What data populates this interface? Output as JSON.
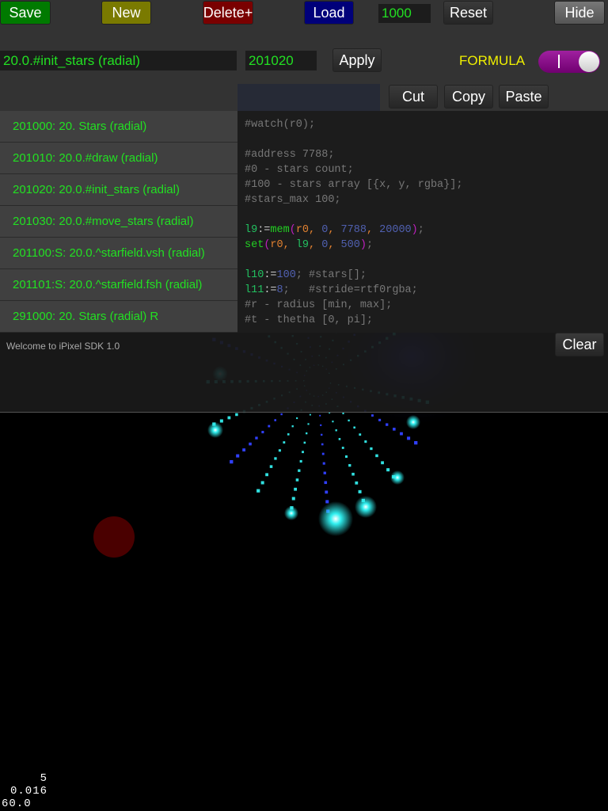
{
  "toolbar": {
    "save": "Save",
    "new": "New",
    "delete": "Delete+",
    "load": "Load",
    "count_value": "1000",
    "reset": "Reset",
    "hide": "Hide"
  },
  "editor": {
    "name_value": "20.0.#init_stars (radial)",
    "id_value": "201020",
    "apply": "Apply",
    "mode_label": "FORMULA",
    "mode_on": true,
    "cut": "Cut",
    "copy": "Copy",
    "paste": "Paste"
  },
  "list": [
    "201000: 20. Stars (radial)",
    "201010: 20.0.#draw (radial)",
    "201020: 20.0.#init_stars (radial)",
    "201030: 20.0.#move_stars (radial)",
    "201100:S: 20.0.^starfield.vsh (radial)",
    "201101:S: 20.0.^starfield.fsh (radial)",
    "291000: 20. Stars (radial) R"
  ],
  "code": {
    "l1": "#watch(r0);",
    "l3": "#address 7788;",
    "l4": "#0 - stars count;",
    "l5": "#100 - stars array [{x, y, rgba}];",
    "l6": "#stars_max 100;",
    "l8a": "l9",
    "l8b": ":=",
    "l8c": "mem",
    "l8d": "r0",
    "l8e": "0",
    "l8f": "7788",
    "l8g": "20000",
    "l9a": "set",
    "l9b": "r0",
    "l9c": "l9",
    "l9d": "0",
    "l9e": "500",
    "l11a": "l10",
    "l11b": "100",
    "l11c": "#stars[];",
    "l12a": "l11",
    "l12b": "8",
    "l12c": "#stride=rtf0rgba;",
    "l13": "#r - radius [min, max];",
    "l14": "#t - thetha [0, pi];"
  },
  "console": {
    "message": "Welcome to iPixel SDK 1.0",
    "clear": "Clear"
  },
  "stats": {
    "line1": "5",
    "line2": "0.016",
    "line3": "60.0"
  },
  "colors": {
    "save": "#007a00",
    "new": "#7a7a00",
    "delete": "#7a0000",
    "load": "#00007a",
    "toggle": "#8a008a",
    "accent_text": "#22e022",
    "formula": "#f0f000"
  }
}
